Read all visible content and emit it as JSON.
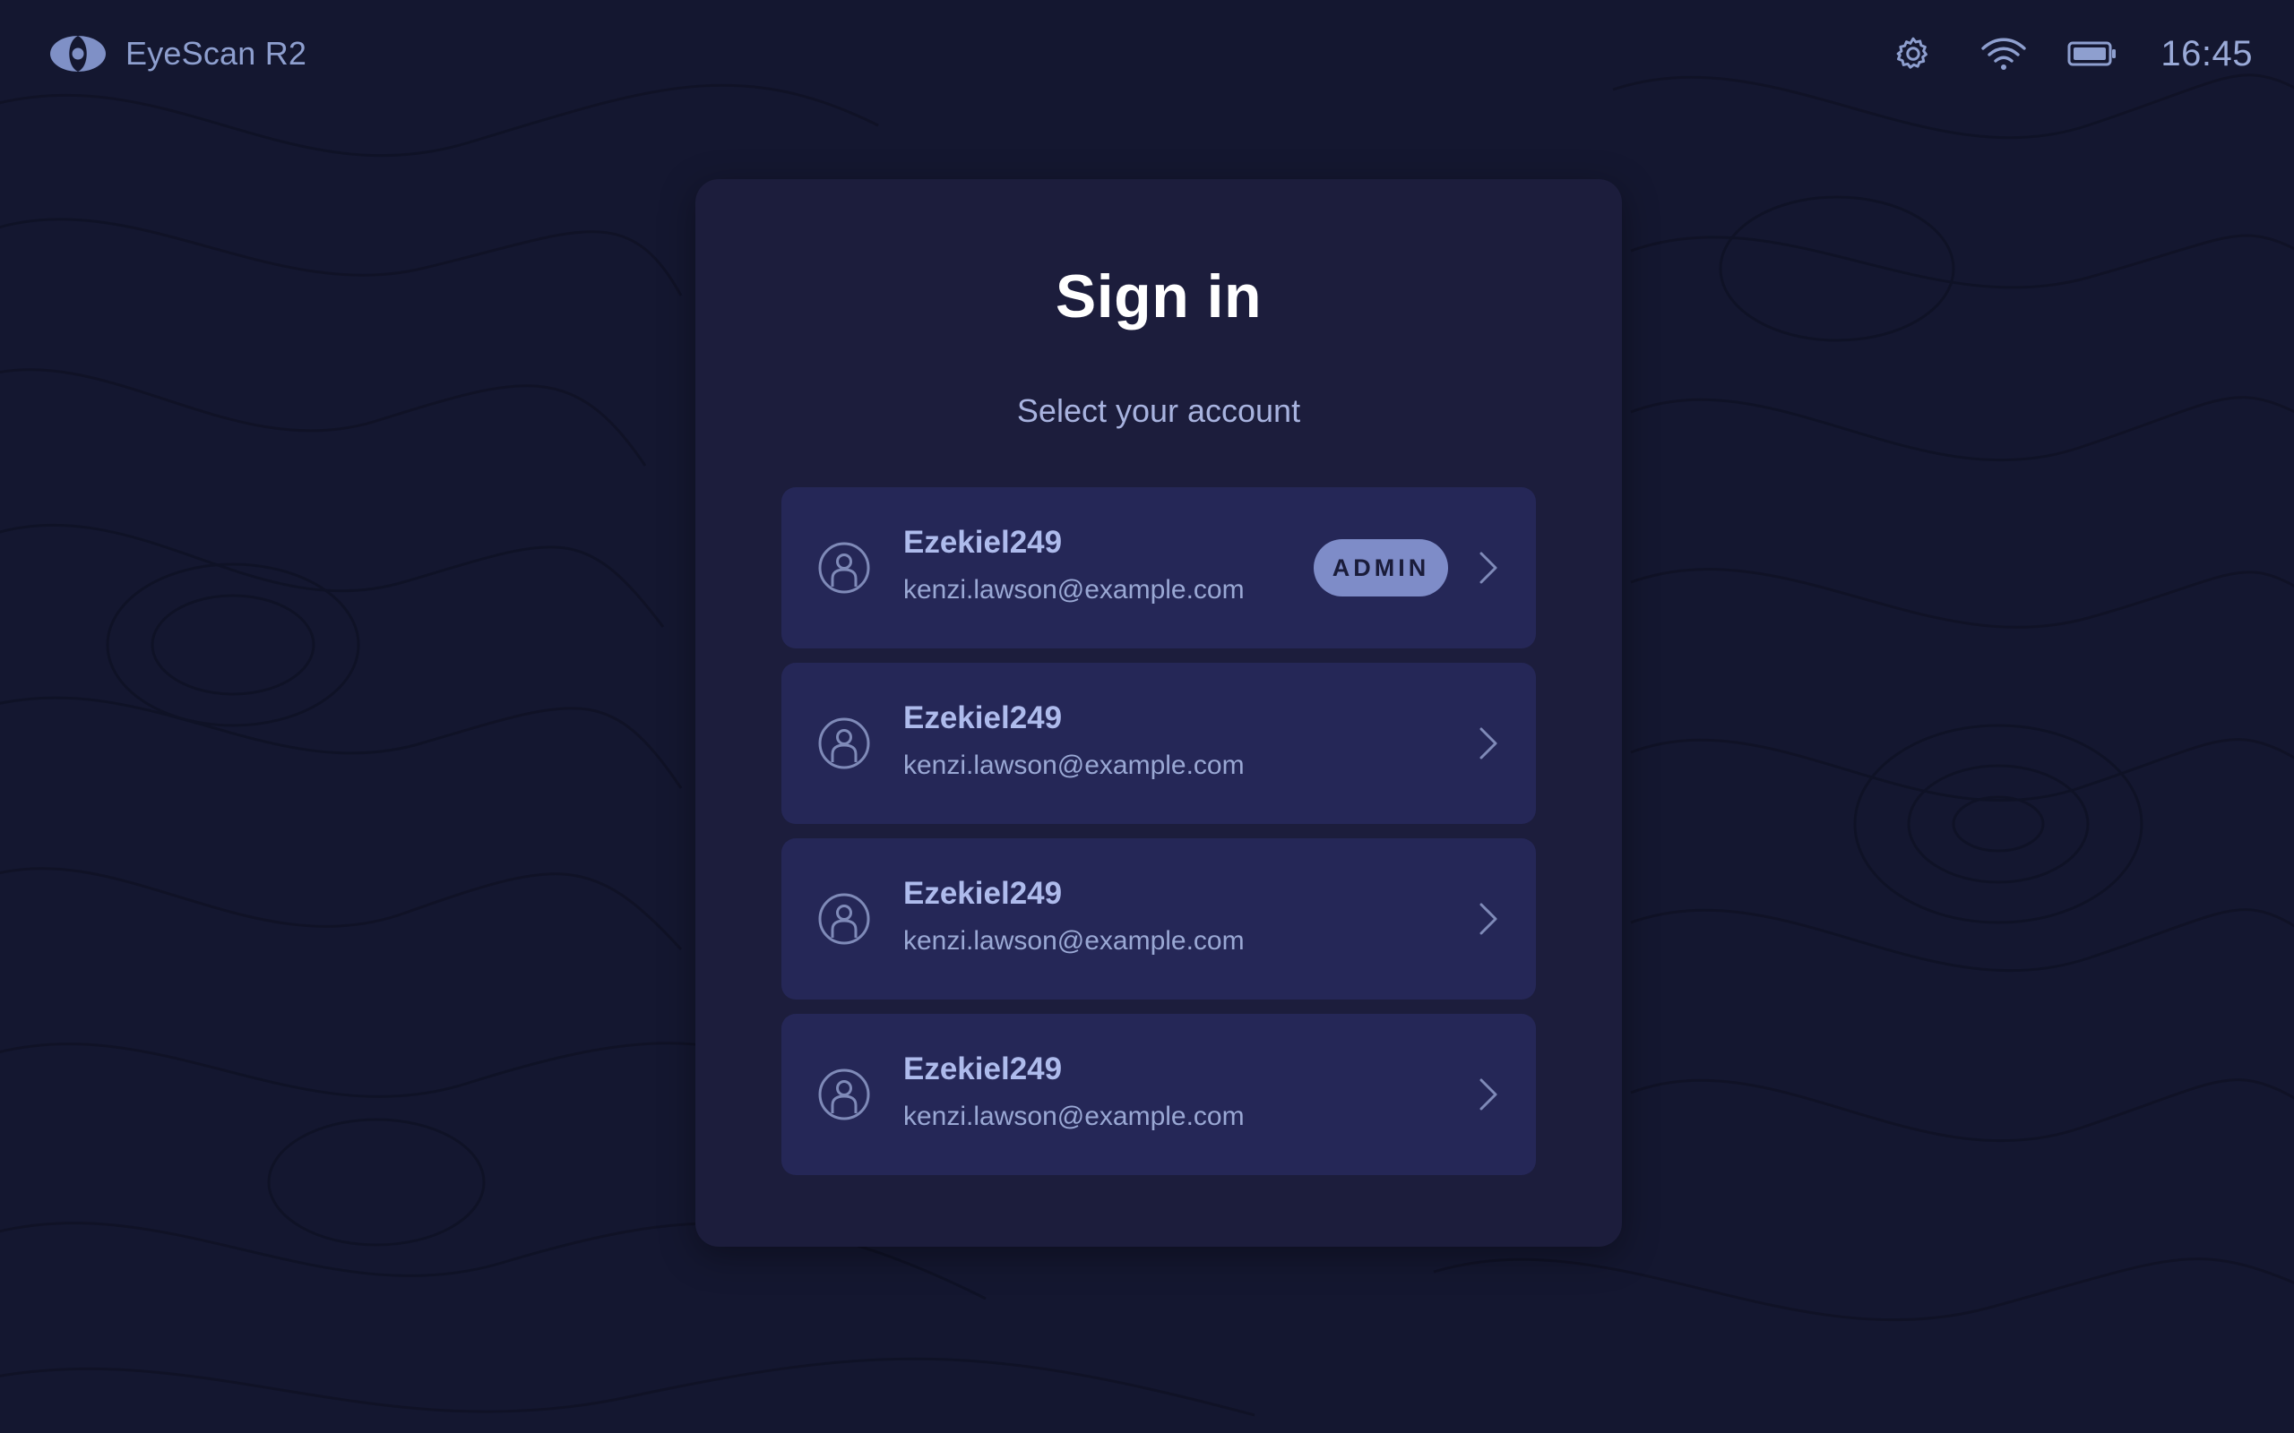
{
  "app": {
    "brand_name": "EyeScan R2",
    "brand_icon": "eye-logo-icon"
  },
  "status_bar": {
    "settings_icon": "gear-icon",
    "wifi_icon": "wifi-icon",
    "battery_icon": "battery-icon",
    "time": "16:45"
  },
  "signin": {
    "title": "Sign in",
    "subtitle": "Select your account",
    "accounts": [
      {
        "username": "Ezekiel249",
        "email": "kenzi.lawson@example.com",
        "badge": "ADMIN"
      },
      {
        "username": "Ezekiel249",
        "email": "kenzi.lawson@example.com"
      },
      {
        "username": "Ezekiel249",
        "email": "kenzi.lawson@example.com"
      },
      {
        "username": "Ezekiel249",
        "email": "kenzi.lawson@example.com"
      }
    ]
  },
  "colors": {
    "background": "#141730",
    "card": "#1c1d3c",
    "row": "#252757",
    "accent": "#7e8cc8",
    "text_muted": "#9aa8d4"
  }
}
